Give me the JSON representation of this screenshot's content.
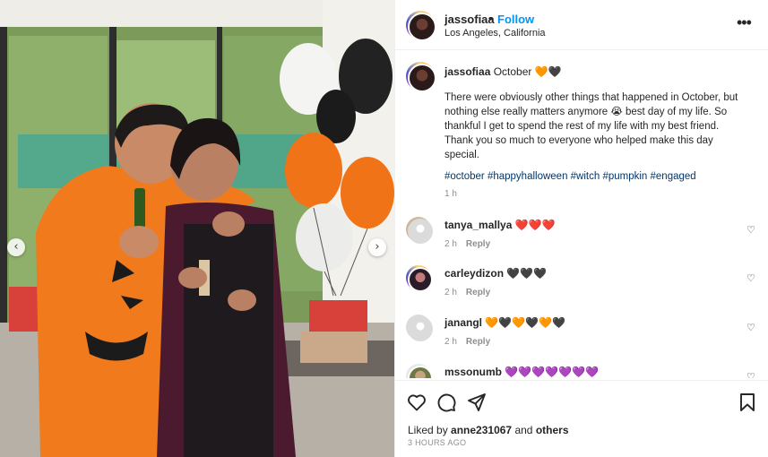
{
  "post": {
    "username": "jassofiaa",
    "dot": "•",
    "follow_label": "Follow",
    "location": "Los Angeles, California",
    "more_label": "•••"
  },
  "caption": {
    "username": "jassofiaa",
    "title": "October 🧡🖤",
    "body": "There were obviously other things that happened in October, but nothing else really matters anymore 😭 best day of my life. So thankful I get to spend the rest of my life with my best friend. Thank you so much to everyone who helped make this day special.",
    "hashtags": "#october #happyhalloween #witch #pumpkin #engaged",
    "time": "1 h"
  },
  "comments": [
    {
      "username": "tanya_mallya",
      "text": "❤️❤️❤️",
      "time": "2 h",
      "reply": "Reply"
    },
    {
      "username": "carleydizon",
      "text": "🖤🖤🖤",
      "time": "2 h",
      "reply": "Reply"
    },
    {
      "username": "janangl",
      "text": "🧡🖤🧡🖤🧡🖤",
      "time": "2 h",
      "reply": "Reply"
    },
    {
      "username": "mssonumb",
      "text": "💜💜💜💜💜💜💜",
      "time": "",
      "reply": ""
    }
  ],
  "footer": {
    "liked_by_prefix": "Liked by",
    "liked_by_user": "anne231067",
    "and_label": "and",
    "others_label": "others",
    "timestamp": "3 HOURS AGO"
  },
  "carousel": {
    "prev": "‹",
    "next": "›"
  }
}
